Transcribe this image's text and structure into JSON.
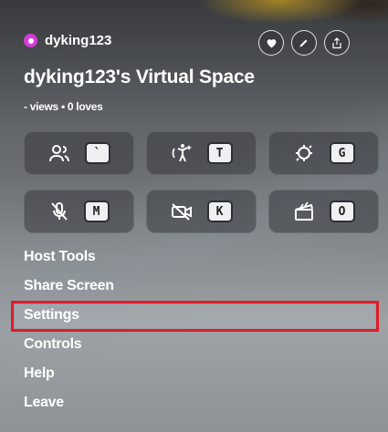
{
  "host": {
    "name": "dyking123",
    "avatar_color": "#d63bd8"
  },
  "space": {
    "title": "dyking123's Virtual Space",
    "stats": "- views • 0 loves"
  },
  "top_actions": [
    "heart-icon",
    "pencil-icon",
    "share-icon"
  ],
  "tiles": [
    {
      "icon": "people-icon",
      "key": "`"
    },
    {
      "icon": "dance-icon",
      "key": "T"
    },
    {
      "icon": "camera-rotate-icon",
      "key": "G"
    },
    {
      "icon": "mic-off-icon",
      "key": "M"
    },
    {
      "icon": "camera-off-icon",
      "key": "K"
    },
    {
      "icon": "clapperboard-icon",
      "key": "O"
    }
  ],
  "menu_items": [
    {
      "label": "Host Tools"
    },
    {
      "label": "Share Screen"
    },
    {
      "label": "Settings"
    },
    {
      "label": "Controls"
    },
    {
      "label": "Help"
    },
    {
      "label": "Leave"
    }
  ],
  "highlight_color": "#e01c2a"
}
